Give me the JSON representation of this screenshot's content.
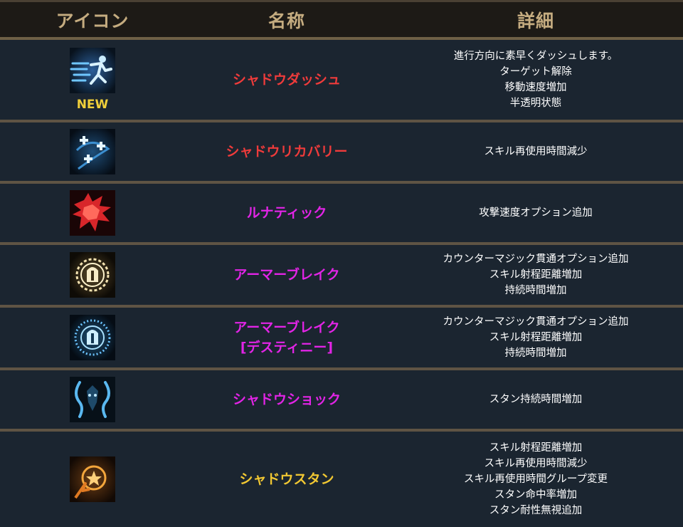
{
  "colors": {
    "header_bg": "#1d1a16",
    "header_text": "#c5ac80",
    "row_bg": "#1b2530",
    "divider": "#5f5444",
    "red": "#ef3b3b",
    "magenta": "#e224e6",
    "yellow": "#f2c832"
  },
  "header": {
    "icon_col": "アイコン",
    "name_col": "名称",
    "details_col": "詳細"
  },
  "rows": [
    {
      "icon": "shadow-dash-icon",
      "badge": "NEW",
      "name": [
        "シャドウダッシュ"
      ],
      "color": "red",
      "details": [
        "進行方向に素早くダッシュします。",
        "ターゲット解除",
        "移動速度増加",
        "半透明状態"
      ]
    },
    {
      "icon": "shadow-recovery-icon",
      "name": [
        "シャドウリカバリー"
      ],
      "color": "red",
      "details": [
        "スキル再使用時間減少"
      ]
    },
    {
      "icon": "lunatic-icon",
      "name": [
        "ルナティック"
      ],
      "color": "magenta",
      "details": [
        "攻撃速度オプション追加"
      ]
    },
    {
      "icon": "armor-break-icon",
      "name": [
        "アーマーブレイク"
      ],
      "color": "magenta",
      "details": [
        "カウンターマジック貫通オプション追加",
        "スキル射程距離増加",
        "持続時間増加"
      ]
    },
    {
      "icon": "armor-break-destiny-icon",
      "name": [
        "アーマーブレイク",
        "[デスティニー]"
      ],
      "color": "magenta",
      "details": [
        "カウンターマジック貫通オプション追加",
        "スキル射程距離増加",
        "持続時間増加"
      ]
    },
    {
      "icon": "shadow-shock-icon",
      "name": [
        "シャドウショック"
      ],
      "color": "magenta",
      "details": [
        "スタン持続時間増加"
      ]
    },
    {
      "icon": "shadow-stun-icon",
      "name": [
        "シャドウスタン"
      ],
      "color": "yellow",
      "details": [
        "スキル射程距離増加",
        "スキル再使用時間減少",
        "スキル再使用時間グループ変更",
        "スタン命中率増加",
        "スタン耐性無視追加"
      ]
    }
  ]
}
